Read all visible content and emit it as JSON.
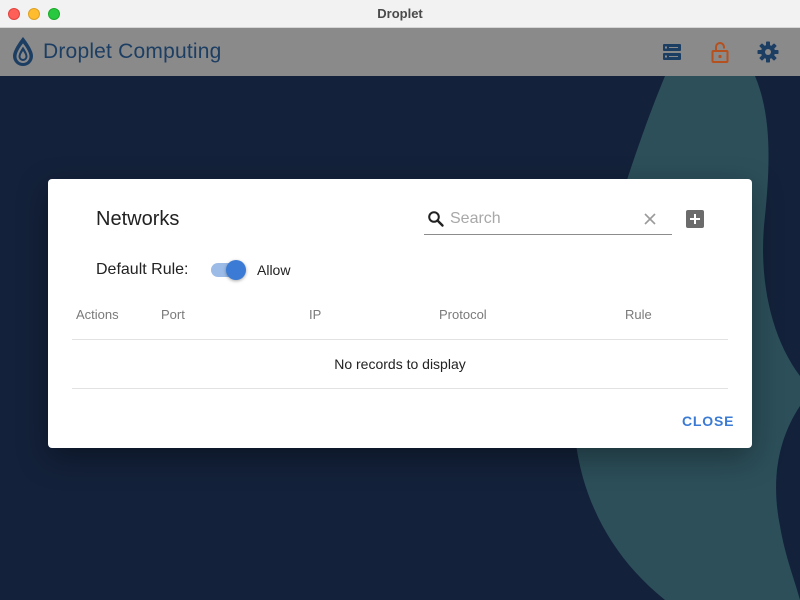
{
  "window": {
    "title": "Droplet"
  },
  "header": {
    "brand_name": "Droplet Computing",
    "icons": [
      "servers-icon",
      "unlocked-lock-icon",
      "gear-icon"
    ]
  },
  "dialog": {
    "title": "Networks",
    "search": {
      "placeholder": "Search",
      "value": ""
    },
    "default_rule": {
      "label": "Default Rule:",
      "toggle_on": true,
      "value_text": "Allow"
    },
    "table": {
      "columns": [
        "Actions",
        "Port",
        "IP",
        "Protocol",
        "Rule"
      ],
      "rows": [],
      "empty_message": "No records to display"
    },
    "close_label": "CLOSE"
  },
  "colors": {
    "header_bg": "#8a8a8a",
    "brand": "#1d3e63",
    "lock_icon": "#b5501f",
    "background": "#13213a",
    "background_accent": "#2c4f5a",
    "accent": "#3b7bd5"
  }
}
